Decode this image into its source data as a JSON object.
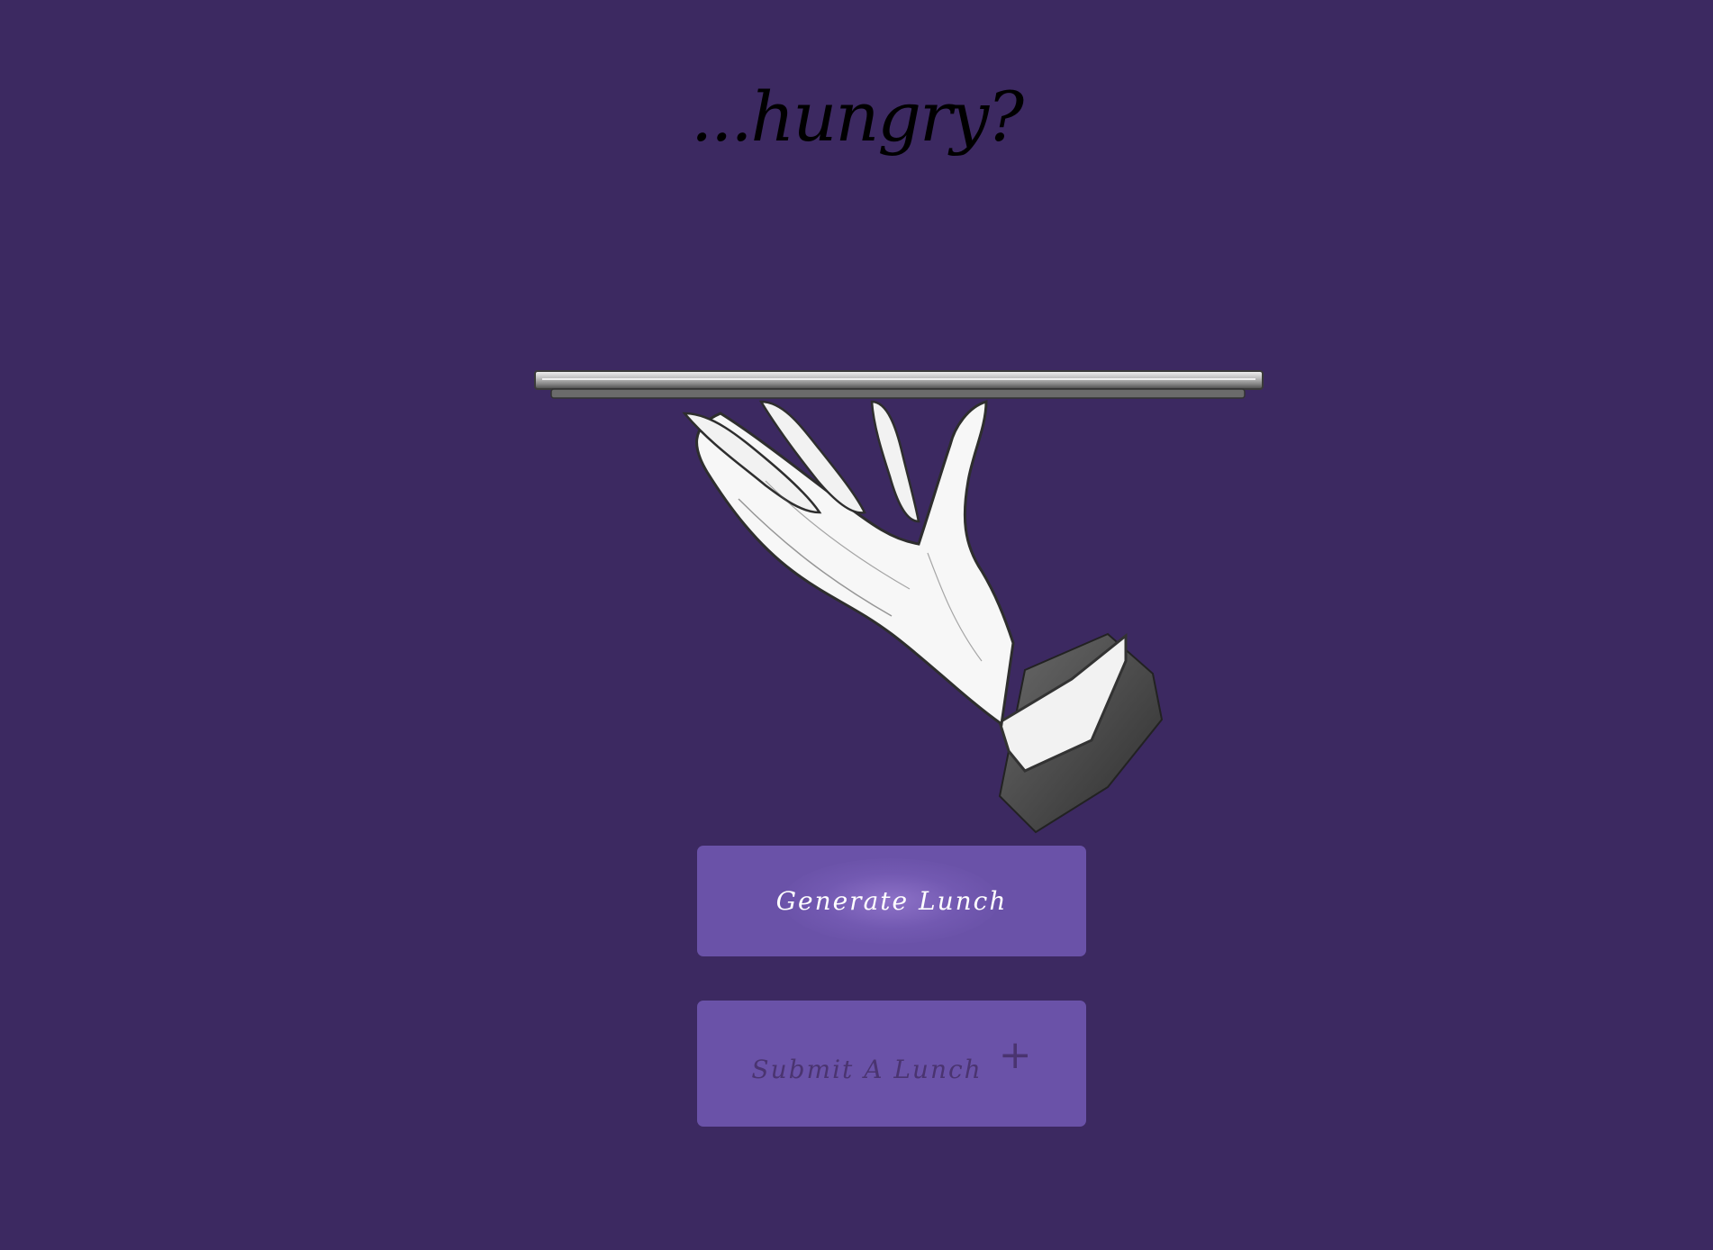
{
  "header": {
    "title": "...hungry?"
  },
  "illustration": {
    "icon": "waiter-hand-tray-icon"
  },
  "buttons": {
    "generate_label": "Generate Lunch",
    "submit_label": "Submit A Lunch",
    "submit_icon": "+"
  },
  "colors": {
    "background": "#3c2961",
    "button": "#6a52a8",
    "title": "#000000",
    "generate_text": "#ffffff",
    "submit_text": "#4a3470"
  }
}
